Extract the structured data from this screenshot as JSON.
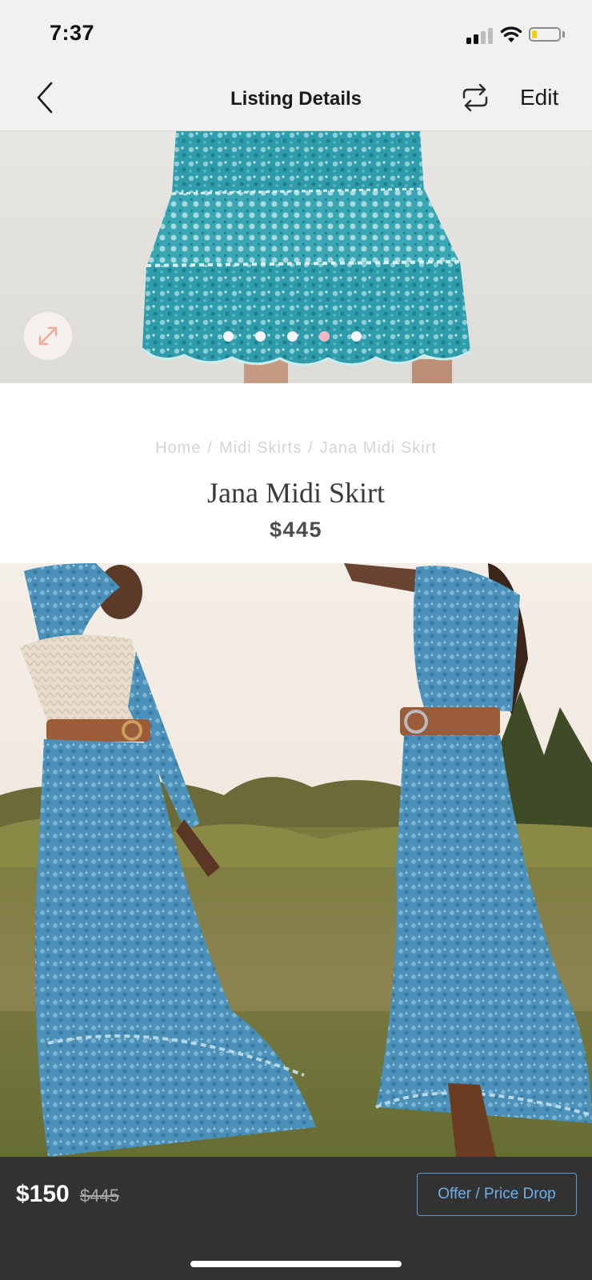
{
  "status_bar": {
    "time": "7:37",
    "signal_icon": "cellular-signal-icon",
    "wifi_icon": "wifi-icon",
    "battery_icon": "battery-low-icon",
    "battery_level": 0.2,
    "battery_color": "#f5d200"
  },
  "nav": {
    "back_icon": "chevron-left-icon",
    "title": "Listing Details",
    "share_icon": "repeat-share-icon",
    "edit_label": "Edit"
  },
  "carousel": {
    "expand_icon": "expand-arrows-icon",
    "expand_icon_color": "#f0a99a",
    "page_count": 5,
    "active_page": 4,
    "active_dot_color": "#f3b7c3",
    "inactive_dot_color": "#f4f4f4"
  },
  "product": {
    "breadcrumb": [
      "Home",
      "Midi Skirts",
      "Jana Midi Skirt"
    ],
    "breadcrumb_separator": "/",
    "title": "Jana Midi Skirt",
    "price": "$445"
  },
  "bottom_bar": {
    "sale_price": "$150",
    "original_price": "$445",
    "offer_button_label": "Offer / Price Drop",
    "accent_color": "#6fb0ea"
  }
}
